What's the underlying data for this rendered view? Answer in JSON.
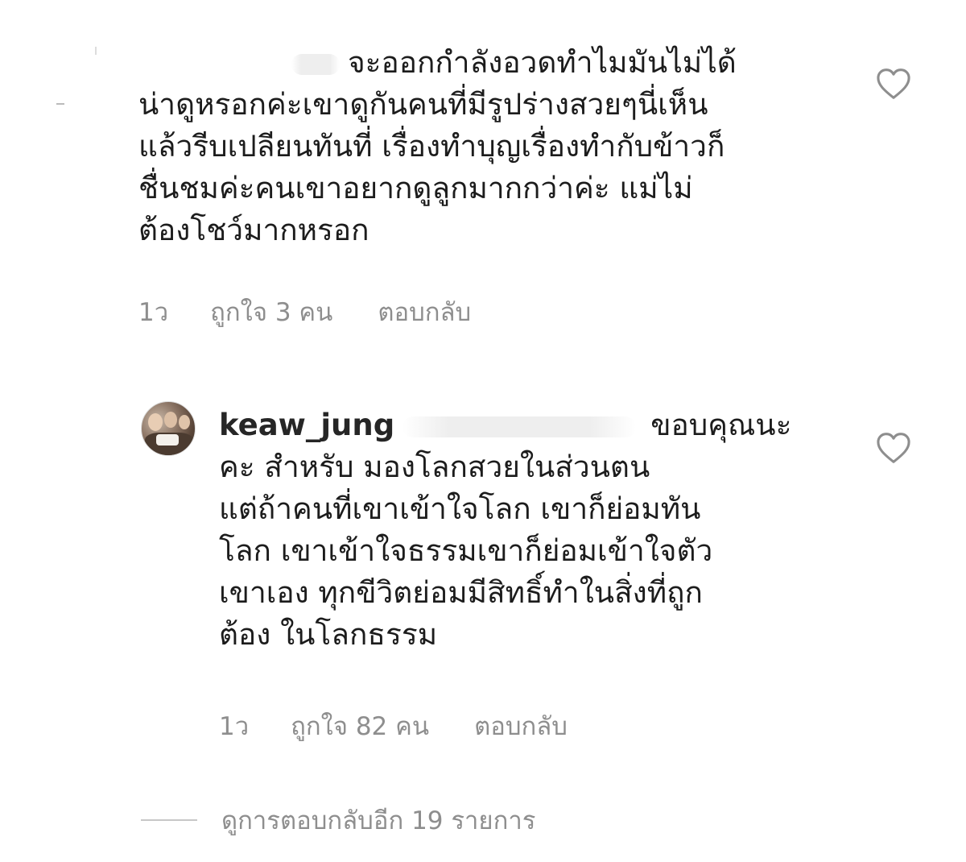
{
  "comments": [
    {
      "lines": [
        "จะออกกำลังอวดทำไมมันไม่ได้",
        "น่าดูหรอกค่ะเขาดูกันคนที่มีรูปร่างสวยๆนี่เห็น",
        "แล้วรีบเปลียนทันที่ เรื่องทำบุญเรื่องทำกับข้าวก็",
        "ชื่นชมค่ะคนเขาอยากดูลูกมากกว่าค่ะ  แม่ไม่",
        "ต้องโชว์มากหรอก"
      ],
      "time": "1ว",
      "likes": "ถูกใจ 3 คน",
      "reply": "ตอบกลับ",
      "like_icon": "heart-outline-icon"
    },
    {
      "username": "keaw_jung",
      "first_line_text": "ขอบคุณนะ",
      "lines": [
        "คะ สำหรับ มองโลกสวยในส่วนตน",
        "แต่ถ้าคนที่เขาเข้าใจโลก เขาก็ย่อมทัน",
        "โลก เขาเข้าใจธรรมเขาก็ย่อมเข้าใจตัว",
        "เขาเอง  ทุกขีวิตย่อมมีสิทธิ์ทำในสิ่งที่ถูก",
        "ต้อง ในโลกธรรม"
      ],
      "time": "1ว",
      "likes": "ถูกใจ 82 คน",
      "reply": "ตอบกลับ",
      "like_icon": "heart-outline-icon",
      "avatar_icon": "avatar-photo"
    }
  ],
  "view_replies": "ดูการตอบกลับอีก 19 รายการ",
  "colors": {
    "text": "#1c1c1c",
    "meta": "#8e8e8e",
    "background": "#ffffff"
  }
}
